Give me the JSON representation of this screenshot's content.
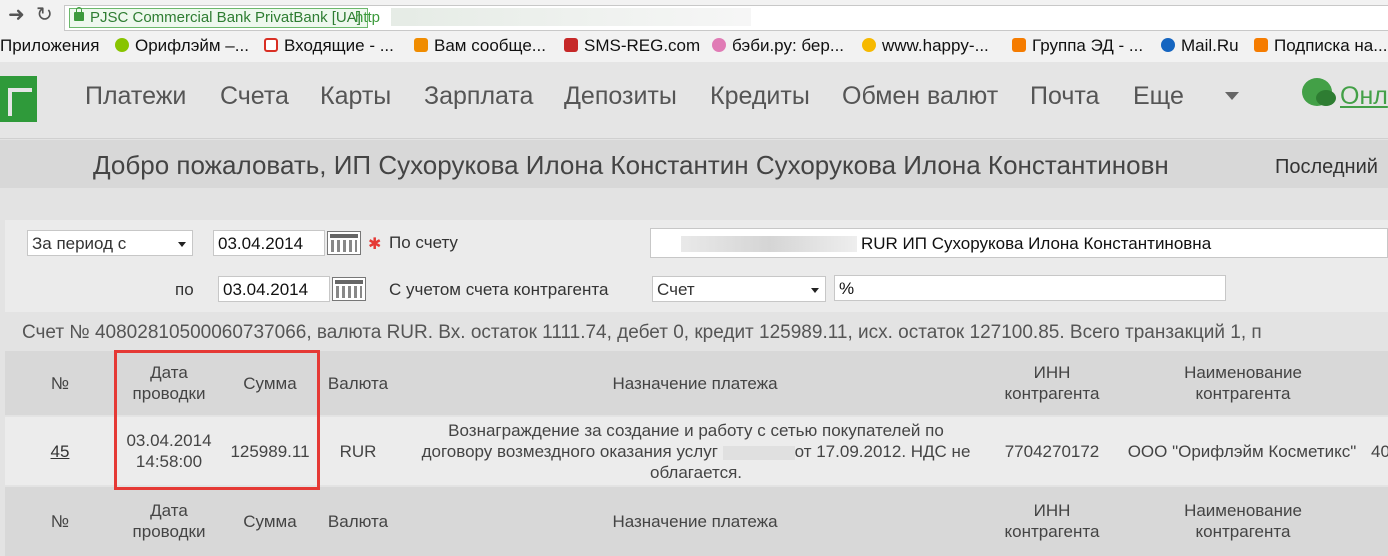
{
  "browser": {
    "site_identity": "PJSC Commercial Bank PrivatBank [UA]",
    "url_visible": "http"
  },
  "bookmarks": [
    {
      "label": "Приложения",
      "icon": "apps-grid-icon",
      "color": "#4a7bd1"
    },
    {
      "label": "Орифлэйм –...",
      "icon": "oriflame-icon",
      "color": "#88c400"
    },
    {
      "label": "Входящие - ...",
      "icon": "gmail-icon",
      "color": "#d93025"
    },
    {
      "label": "Вам сообще...",
      "icon": "odnoklassniki-icon",
      "color": "#f08c00"
    },
    {
      "label": "SMS-REG.com",
      "icon": "sms-reg-icon",
      "color": "#c62828"
    },
    {
      "label": "бэби.ру: бер...",
      "icon": "baby-ru-icon",
      "color": "#e07bb5"
    },
    {
      "label": "www.happy-...",
      "icon": "happy-icon",
      "color": "#f6b900"
    },
    {
      "label": "Группа ЭД - ...",
      "icon": "blogger-icon",
      "color": "#f57c00"
    },
    {
      "label": "Mail.Ru",
      "icon": "mail-ru-icon",
      "color": "#1565c0"
    },
    {
      "label": "Подписка на...",
      "icon": "blogger-icon",
      "color": "#f57c00"
    }
  ],
  "nav": {
    "items": [
      "Платежи",
      "Счета",
      "Карты",
      "Зарплата",
      "Депозиты",
      "Кредиты",
      "Обмен валют",
      "Почта",
      "Еще"
    ],
    "online": "Онл"
  },
  "welcome": {
    "text": "Добро пожаловать, ИП Сухорукова Илона Константин Сухорукова Илона Константиновн",
    "last": "Последний"
  },
  "filters": {
    "period_select": "За период с",
    "date_from": "03.04.2014",
    "to_label": "по",
    "date_to": "03.04.2014",
    "account_label": "По счету",
    "account_value": "RUR ИП Сухорукова Илона Константиновна",
    "contragent_label": "С учетом счета контрагента",
    "contragent_select": "Счет",
    "percent": "%"
  },
  "summary": "Счет № 40802810500060737066, валюта RUR. Вх. остаток 1111.74, дебет 0, кредит 125989.11, исх. остаток 127100.85. Всего транзакций 1, п",
  "table": {
    "headers": [
      "№",
      "Дата проводки",
      "Сумма",
      "Валюта",
      "Назначение платежа",
      "ИНН контрагента",
      "Наименование контрагента"
    ],
    "rows": [
      {
        "num": "45",
        "date": "03.04.2014",
        "time": "14:58:00",
        "sum": "125989.11",
        "currency": "RUR",
        "purpose_1": "Вознаграждение за создание и работу с сетью покупателей по",
        "purpose_2a": "договору возмездного оказания услуг",
        "purpose_2b": "от 17.09.2012. НДС не",
        "purpose_3": "облагается.",
        "inn": "7704270172",
        "name": "ООО \"Орифлэйм Косметикс\"",
        "extra": "40"
      }
    ]
  },
  "colors": {
    "brand_green": "#2f9a3a",
    "highlight": "#e53935"
  }
}
